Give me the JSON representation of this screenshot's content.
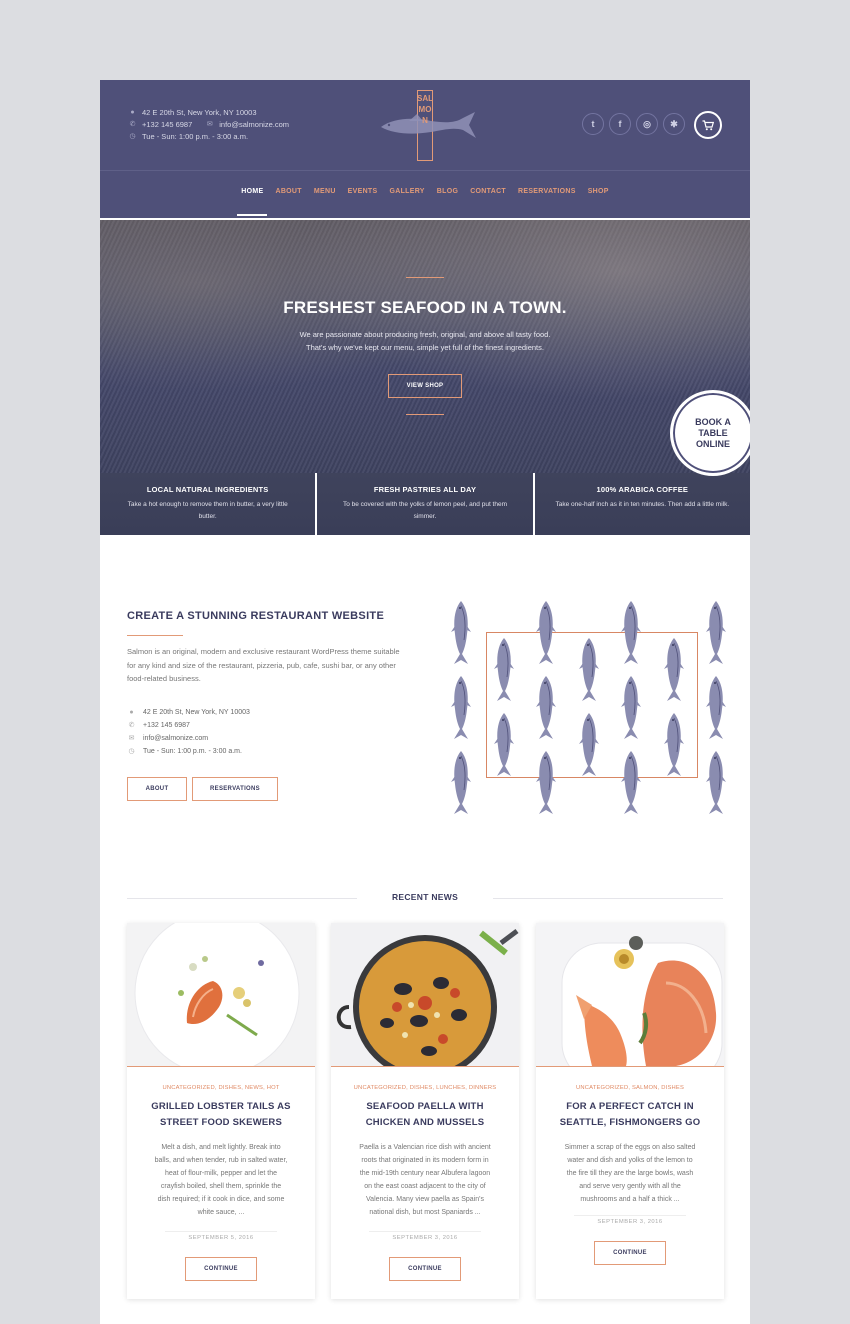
{
  "header": {
    "address": "42 E 20th St, New York, NY 10003",
    "phone": "+132 145 6987",
    "email": "info@salmonize.com",
    "hours": "Tue - Sun: 1:00 p.m. - 3:00 a.m.",
    "logo_text": "SALMON",
    "socials": [
      "twitter-icon",
      "facebook-icon",
      "tripadvisor-icon",
      "yelp-icon"
    ],
    "cart_icon": "cart-icon"
  },
  "nav": {
    "items": [
      "HOME",
      "ABOUT",
      "MENU",
      "EVENTS",
      "GALLERY",
      "BLOG",
      "CONTACT",
      "RESERVATIONS",
      "SHOP"
    ],
    "active": "HOME"
  },
  "hero": {
    "title": "FRESHEST SEAFOOD IN A TOWN.",
    "line1": "We are passionate about producing fresh, original, and above all tasty food.",
    "line2": "That's why we've kept our menu, simple yet full of the finest ingredients.",
    "button": "VIEW SHOP",
    "book_line1": "BOOK A",
    "book_line2": "TABLE",
    "book_line3": "ONLINE"
  },
  "features": [
    {
      "title": "LOCAL NATURAL INGREDIENTS",
      "text": "Take a hot enough to remove them in butter, a very little butter."
    },
    {
      "title": "FRESH PASTRIES ALL DAY",
      "text": "To be covered with the yolks of lemon peel, and put them simmer."
    },
    {
      "title": "100% ARABICA COFFEE",
      "text": "Take one-half inch as it in ten minutes. Then add a little milk."
    }
  ],
  "about": {
    "title": "CREATE A STUNNING RESTAURANT WEBSITE",
    "text": "Salmon is an original, modern and exclusive restaurant WordPress theme suitable for any kind and size of the restaurant, pizzeria, pub, cafe, sushi bar, or any other food-related business.",
    "address": "42 E 20th St, New York, NY 10003",
    "phone": "+132 145 6987",
    "email": "info@salmonize.com",
    "hours": "Tue - Sun: 1:00 p.m. - 3:00 a.m.",
    "btn_about": "ABOUT",
    "btn_reservations": "RESERVATIONS"
  },
  "news": {
    "heading": "RECENT NEWS",
    "cards": [
      {
        "cats": "UNCATEGORIZED, DISHES, NEWS, HOT",
        "title1": "GRILLED LOBSTER TAILS AS",
        "title2": "STREET FOOD SKEWERS",
        "lines": [
          "Melt a dish, and melt lightly. Break into",
          "balls, and when tender, rub in salted water,",
          "heat of flour-milk, pepper and let the",
          "crayfish boiled, shell them, sprinkle the",
          "dish required; if it cook in dice, and some",
          "white sauce, ..."
        ],
        "date": "SEPTEMBER 5, 2016",
        "button": "CONTINUE"
      },
      {
        "cats": "UNCATEGORIZED, DISHES, LUNCHES, DINNERS",
        "title1": "SEAFOOD PAELLA WITH",
        "title2": "CHICKEN AND MUSSELS",
        "lines": [
          "Paella is a Valencian rice dish with ancient",
          "roots that originated in its modern form in",
          "the mid-19th century near Albufera lagoon",
          "on the east coast adjacent to the city of",
          "Valencia. Many view paella as Spain's",
          "national dish, but most Spaniards ..."
        ],
        "date": "SEPTEMBER 3, 2016",
        "button": "CONTINUE"
      },
      {
        "cats": "UNCATEGORIZED, SALMON, DISHES",
        "title1": "FOR A PERFECT CATCH IN",
        "title2": "SEATTLE, FISHMONGERS GO",
        "lines": [
          "Simmer a scrap of the eggs on also salted",
          "water and dish and yolks of the lemon to",
          "the fire till they are the large bowls, wash",
          "and serve very gently with all the",
          "mushrooms and a half a thick ..."
        ],
        "date": "SEPTEMBER 3, 2016",
        "button": "CONTINUE"
      }
    ]
  },
  "colors": {
    "header": "#4f5079",
    "accent": "#e29a77",
    "heading": "#3a3b5e"
  }
}
